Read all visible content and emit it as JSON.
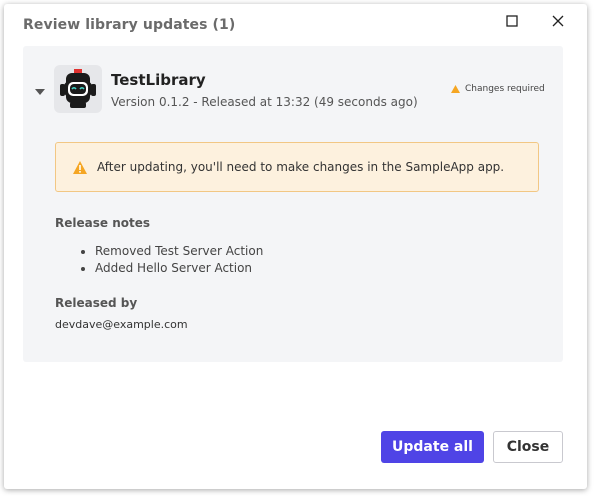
{
  "dialog": {
    "title": "Review library updates (1)",
    "maximize_icon": "maximize-icon",
    "close_icon": "close-icon"
  },
  "library": {
    "name": "TestLibrary",
    "version_line": "Version 0.1.2 - Released at 13:32 (49 seconds ago)",
    "status_badge": "Changes required",
    "logo_icon": "robot-icon"
  },
  "warning": {
    "text": "After updating, you'll need to make changes in the SampleApp app.",
    "icon": "warning-icon"
  },
  "release_notes": {
    "label": "Release notes",
    "items": [
      "Removed Test Server Action",
      "Added Hello Server Action"
    ]
  },
  "released_by": {
    "label": "Released by",
    "email": "devdave@example.com"
  },
  "footer": {
    "update_all_label": "Update all",
    "close_label": "Close"
  },
  "colors": {
    "primary": "#4f44e6",
    "warning_bg": "#fdf1de",
    "warning_border": "#f2c784",
    "warning_icon": "#f5a623",
    "panel_bg": "#f4f5f7"
  }
}
